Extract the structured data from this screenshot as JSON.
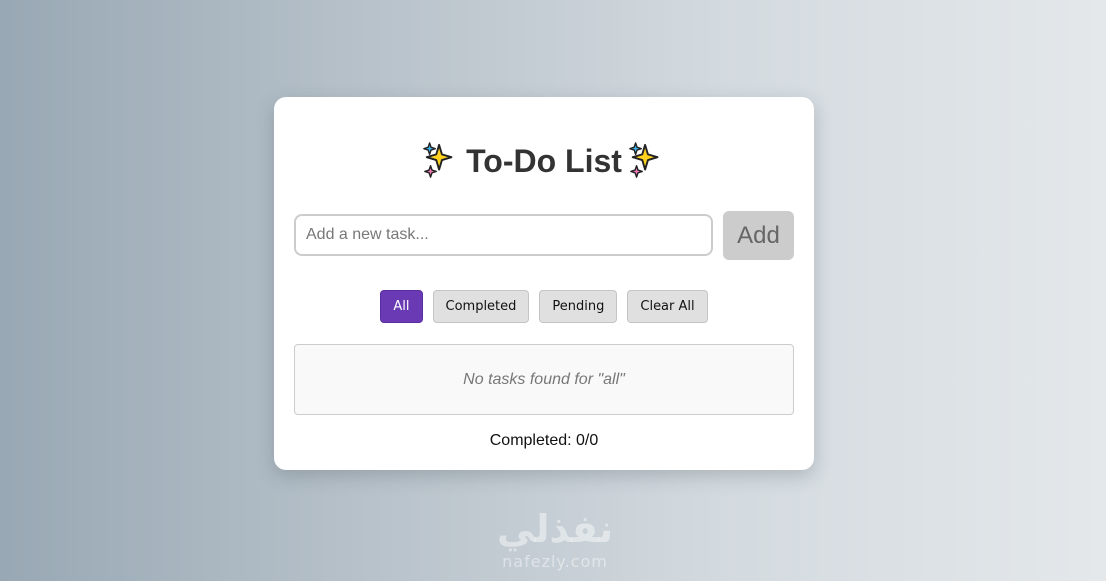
{
  "app": {
    "title": "To-Do List"
  },
  "input": {
    "placeholder": "Add a new task...",
    "value": ""
  },
  "add_button": {
    "label": "Add"
  },
  "filters": [
    {
      "label": "All",
      "active": true
    },
    {
      "label": "Completed",
      "active": false
    },
    {
      "label": "Pending",
      "active": false
    },
    {
      "label": "Clear All",
      "active": false
    }
  ],
  "task_list": {
    "empty_message": "No tasks found for \"all\""
  },
  "counter": {
    "text": "Completed: 0/0"
  },
  "watermark": {
    "arabic": "نفذلي",
    "latin": "nafezly.com"
  },
  "icons": {
    "title_left": "sparkles-icon",
    "title_right": "sparkles-icon"
  },
  "colors": {
    "accent": "#6a3ab5",
    "button_gray": "#cccccc",
    "card_bg": "#ffffff"
  }
}
